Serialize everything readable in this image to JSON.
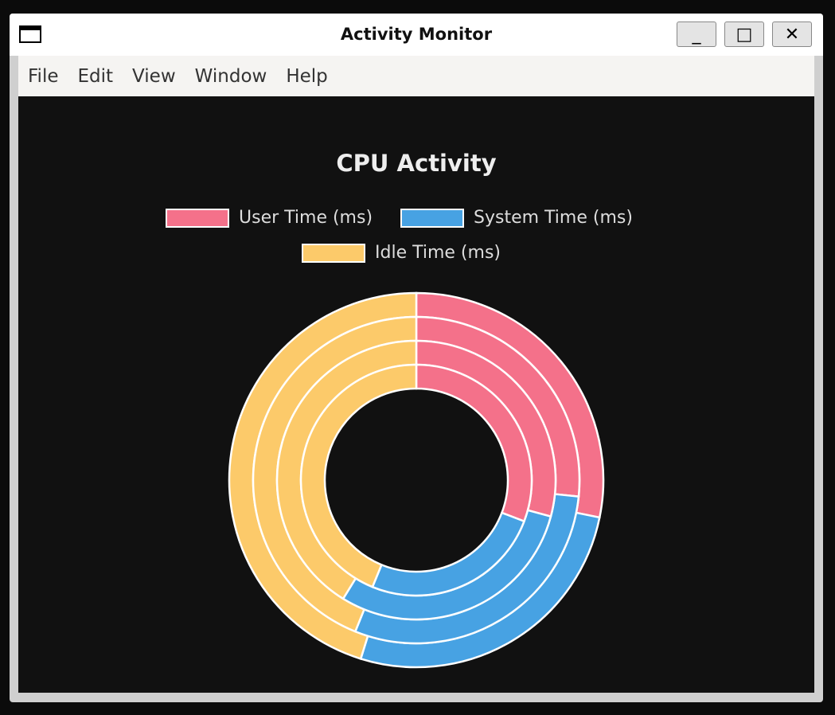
{
  "window": {
    "title": "Activity Monitor",
    "minimize": "_",
    "maximize": "□",
    "close": "✕"
  },
  "menu": [
    "File",
    "Edit",
    "View",
    "Window",
    "Help"
  ],
  "chart_data": {
    "type": "doughnut",
    "title": "CPU Activity",
    "labels": [
      "User Time (ms)",
      "System Time (ms)",
      "Idle Time (ms)"
    ],
    "colors": [
      "#f4718a",
      "#47a2e3",
      "#fcca6a"
    ],
    "legend": "top",
    "datasets": [
      {
        "values": [
          282,
          266,
          452
        ]
      },
      {
        "values": [
          266,
          295,
          439
        ]
      },
      {
        "values": [
          292,
          296,
          412
        ]
      },
      {
        "values": [
          308,
          254,
          438
        ]
      }
    ]
  }
}
